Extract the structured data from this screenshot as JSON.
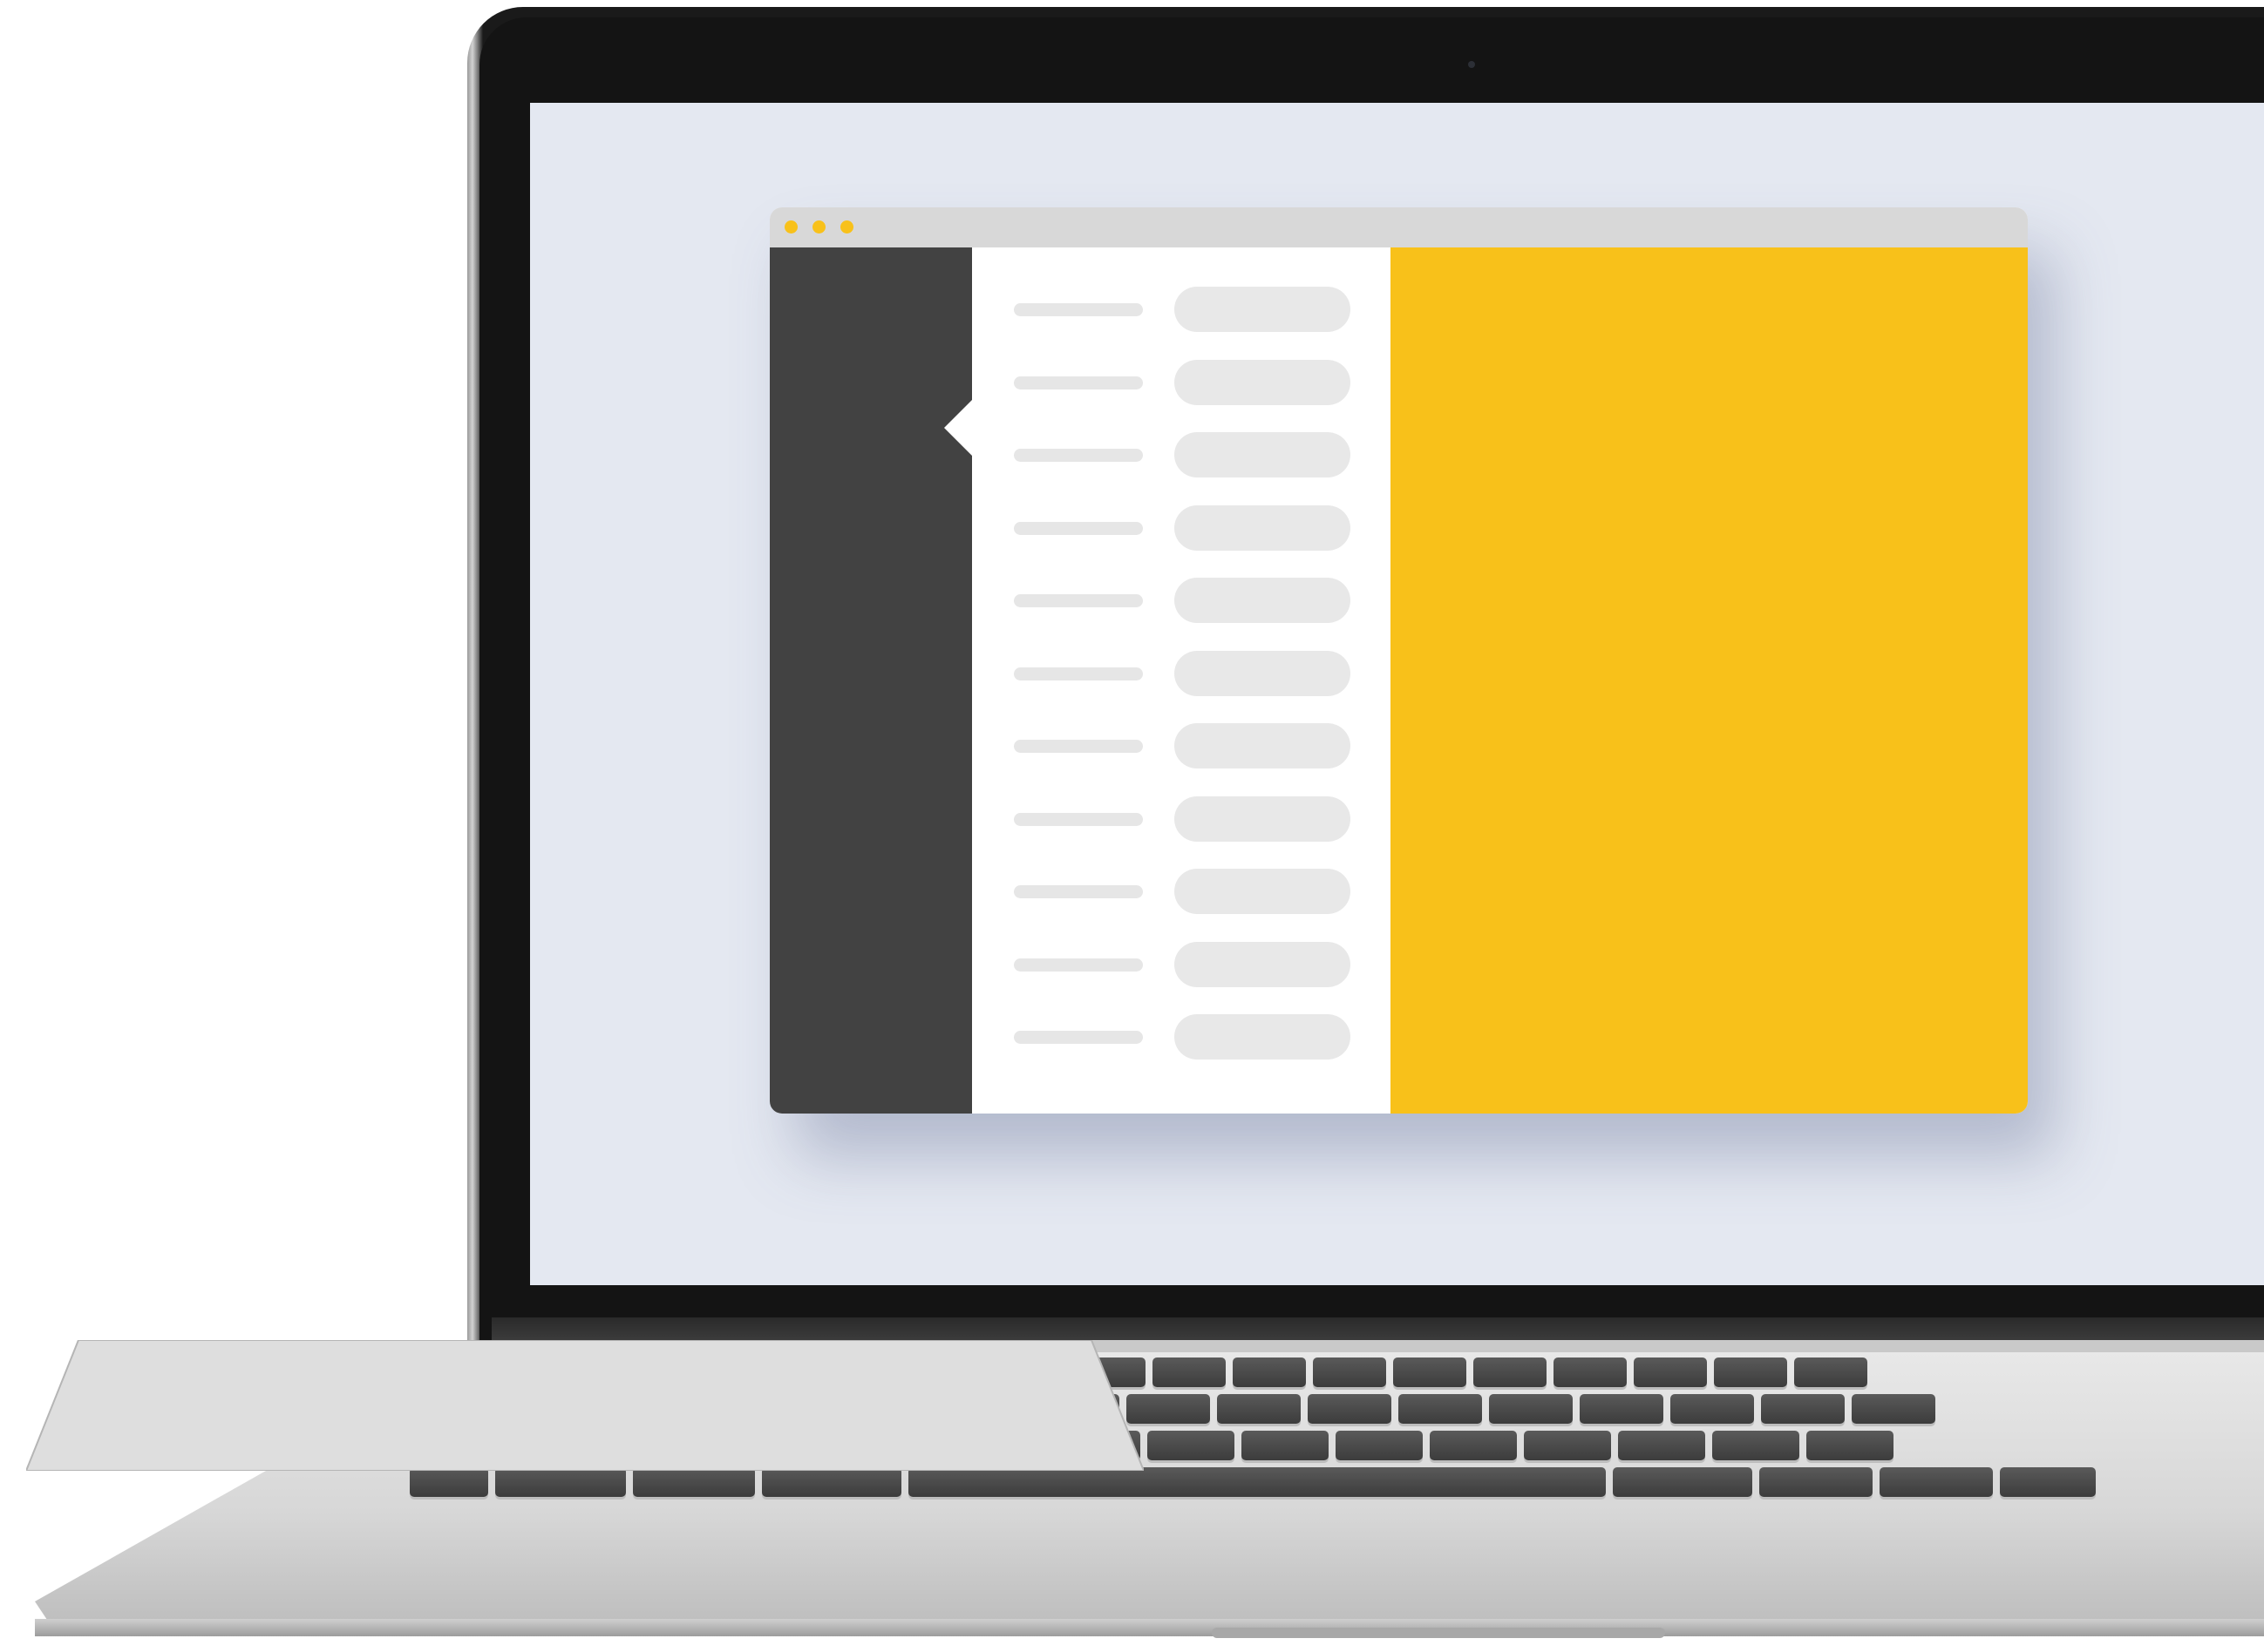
{
  "colors": {
    "accent": "#f8c11a",
    "sidebar": "#424242",
    "titlebar": "#d8d8d8",
    "screen_background": "#e4e8f1",
    "list_background": "#ffffff",
    "placeholder": "#e8e8e8"
  },
  "window": {
    "traffic_lights": [
      "dot",
      "dot",
      "dot"
    ],
    "list_row_count": 11
  },
  "icons": {
    "window_controls": "traffic-light-dots",
    "sidebar_pointer": "caret-left-icon",
    "camera": "camera-icon"
  }
}
